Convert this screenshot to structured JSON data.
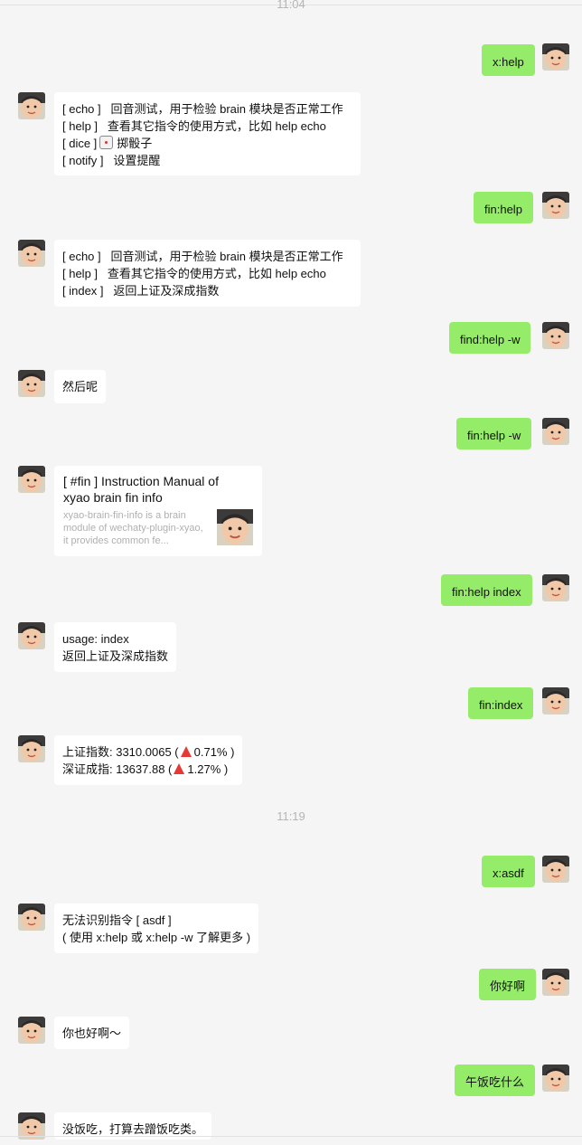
{
  "timestamps": [
    "11:04",
    "11:19"
  ],
  "messages": [
    {
      "dir": "out",
      "lines": [
        "x:help"
      ]
    },
    {
      "dir": "in",
      "lines": [
        "[ echo ]   回音测试，用于检验 brain 模块是否正常工作",
        "[ help ]   查看其它指令的使用方式，比如 help echo",
        "[ dice ]",
        "[ notify ]   设置提醒"
      ],
      "dice_label": "掷骰子"
    },
    {
      "dir": "out",
      "lines": [
        "fin:help"
      ]
    },
    {
      "dir": "in",
      "lines": [
        "[ echo ]   回音测试，用于检验 brain 模块是否正常工作",
        "[ help ]   查看其它指令的使用方式，比如 help echo",
        "[ index ]   返回上证及深成指数"
      ]
    },
    {
      "dir": "out",
      "lines": [
        "find:help -w"
      ]
    },
    {
      "dir": "in",
      "lines": [
        "然后呢"
      ]
    },
    {
      "dir": "out",
      "lines": [
        "fin:help -w"
      ]
    },
    {
      "dir": "in",
      "card": {
        "title": "[ #fin ] Instruction Manual of xyao brain fin info",
        "desc": "xyao-brain-fin-info is a brain module of wechaty-plugin-xyao, it provides common fe..."
      }
    },
    {
      "dir": "out",
      "lines": [
        "fin:help index"
      ]
    },
    {
      "dir": "in",
      "lines": [
        "usage: index",
        "返回上证及深成指数"
      ]
    },
    {
      "dir": "out",
      "lines": [
        "fin:index"
      ]
    },
    {
      "dir": "in",
      "index": [
        {
          "label": "上证指数: 3310.0065 (",
          "change": "0.71% )"
        },
        {
          "label": "深证成指: 13637.88 (",
          "change": "1.27% )"
        }
      ]
    },
    {
      "dir": "out",
      "lines": [
        "x:asdf"
      ]
    },
    {
      "dir": "in",
      "lines": [
        "无法识别指令 [ asdf ]",
        "( 使用 x:help 或 x:help -w 了解更多 )"
      ]
    },
    {
      "dir": "out",
      "lines": [
        "你好啊"
      ]
    },
    {
      "dir": "in",
      "lines": [
        "你也好啊～"
      ]
    },
    {
      "dir": "out",
      "lines": [
        "午饭吃什么"
      ]
    },
    {
      "dir": "in",
      "lines": [
        "没饭吃，打算去蹭饭吃类。"
      ]
    }
  ],
  "colors": {
    "out_bubble": "#95ec69",
    "in_bubble": "#ffffff",
    "background": "#f5f5f5",
    "up_arrow": "#e53935"
  },
  "icons": {
    "avatar": "child-avatar-photo",
    "up": "red-up-triangle-icon",
    "dice": "dice-icon"
  }
}
